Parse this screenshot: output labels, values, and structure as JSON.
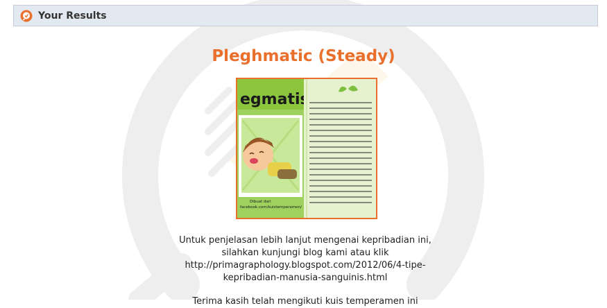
{
  "header": {
    "title": "Your Results",
    "icon": "speech-bubble-icon",
    "accent": "#e8702c",
    "background": "#e3e9f1"
  },
  "result": {
    "title": "Pleghmatic (Steady)",
    "title_color": "#e8702c",
    "image": {
      "heading": "egmatis",
      "caption_line1": "Dibuat dari",
      "caption_line2": "facebook.com/kuistemperamen/"
    }
  },
  "description": {
    "lines": [
      "Untuk penjelasan lebih lanjut mengenai kepribadian ini,",
      "silahkan kunjungi blog kami atau klik",
      "http://primagraphology.blogspot.com/2012/06/4-tipe-",
      "kepribadian-manusia-sanguinis.html"
    ],
    "clipped_line": "Terima kasih telah mengikuti kuis temperamen ini"
  }
}
